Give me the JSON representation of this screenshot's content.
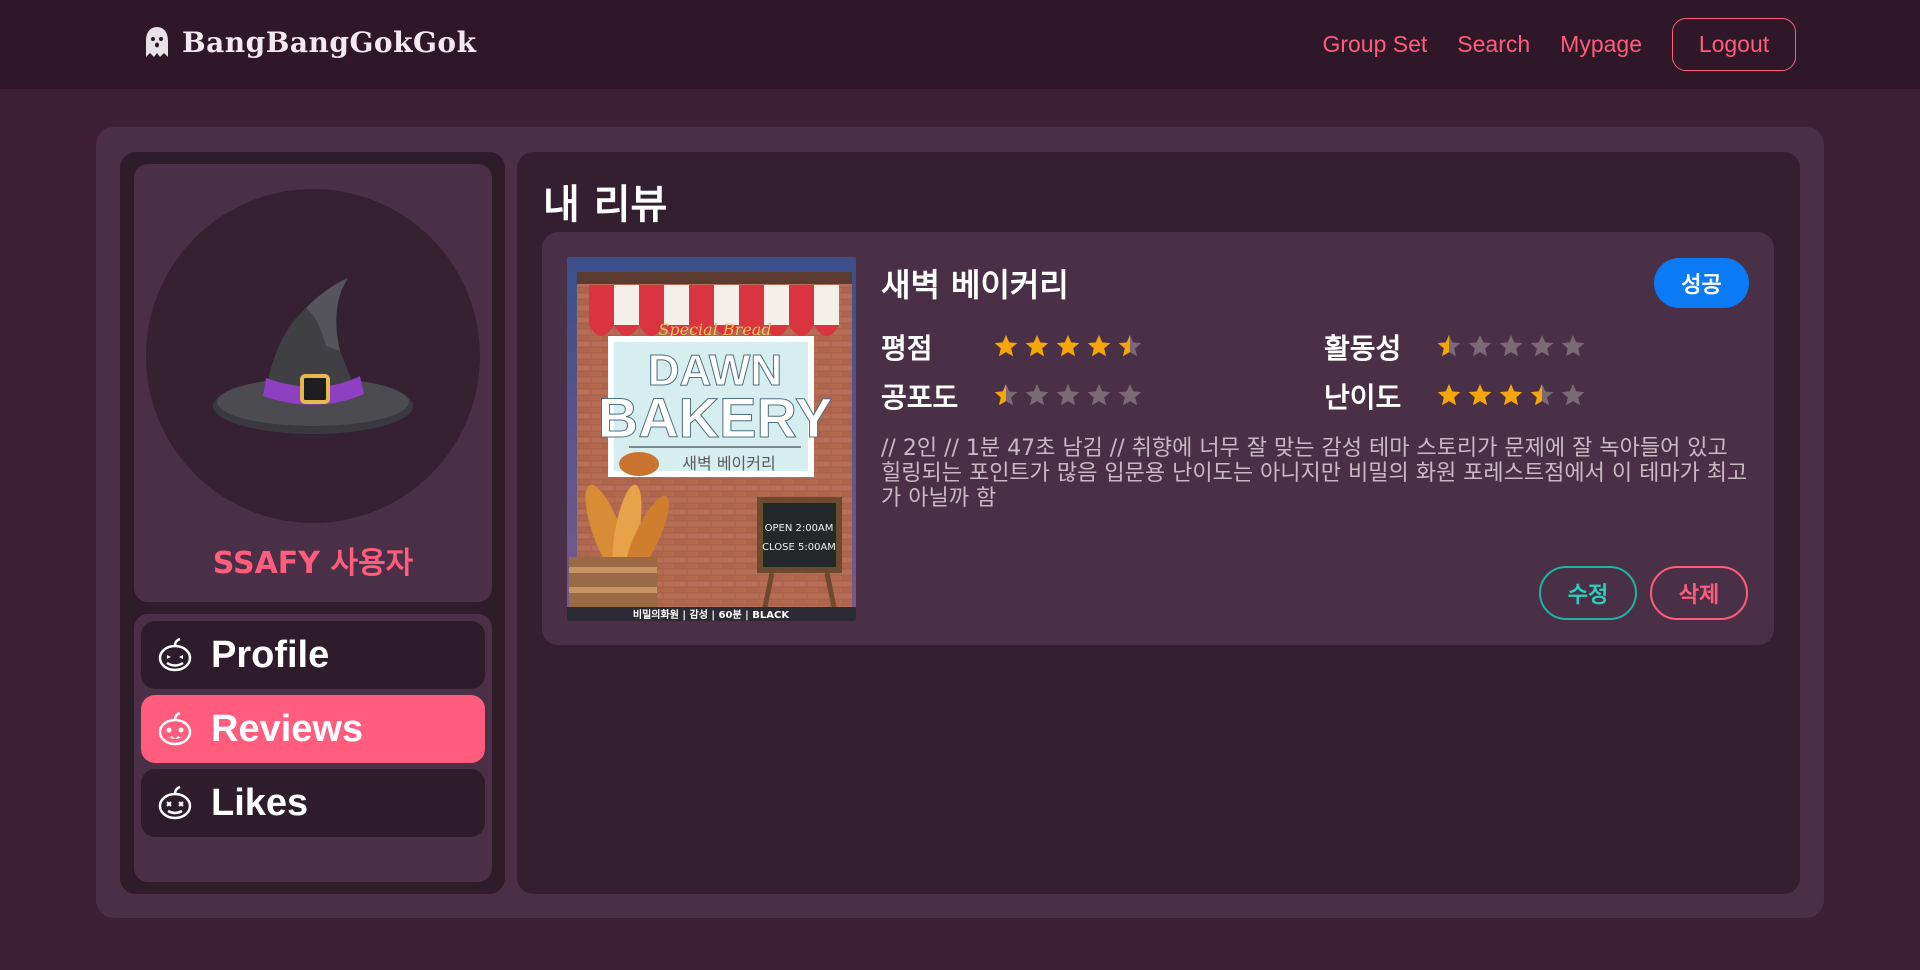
{
  "header": {
    "brand": "BangBangGokGok",
    "nav": [
      "Group Set",
      "Search",
      "Mypage"
    ],
    "logout": "Logout"
  },
  "profile": {
    "username": "SSAFY 사용자",
    "avatar_icon": "witch-hat-icon"
  },
  "menu": [
    {
      "label": "Profile",
      "icon": "pumpkin-icon",
      "active": false
    },
    {
      "label": "Reviews",
      "icon": "pumpkin-icon",
      "active": true
    },
    {
      "label": "Likes",
      "icon": "pumpkin-icon",
      "active": false
    }
  ],
  "main": {
    "title": "내 리뷰",
    "reviews": [
      {
        "theme_title": "새벽 베이커리",
        "status": "성공",
        "ratings": [
          {
            "label": "평점",
            "value": 4.5
          },
          {
            "label": "활동성",
            "value": 0.5
          },
          {
            "label": "공포도",
            "value": 0.5
          },
          {
            "label": "난이도",
            "value": 3.5
          }
        ],
        "content": "// 2인 // 1분 47초 남김 // 취향에 너무 잘 맞는 감성 테마 스토리가 문제에 잘 녹아들어 있고 힐링되는 포인트가 많음 입문용 난이도는 아니지만 비밀의 화원 포레스트점에서 이 테마가 최고가 아닐까 함",
        "edit": "수정",
        "delete": "삭제",
        "poster": {
          "sign_top": "Special Bread",
          "sign_line1": "DAWN",
          "sign_line2": "BAKERY",
          "sign_korean": "새벽 베이커리",
          "board_open": "OPEN 2:00AM",
          "board_close": "CLOSE 5:00AM",
          "footer": "비밀의화원 | 감성 | 60분 | BLACK"
        }
      }
    ]
  },
  "colors": {
    "accent": "#ff5c7e",
    "badge": "#0a7bf5",
    "edit": "#1fb3a4",
    "star": "#f5a70a"
  }
}
